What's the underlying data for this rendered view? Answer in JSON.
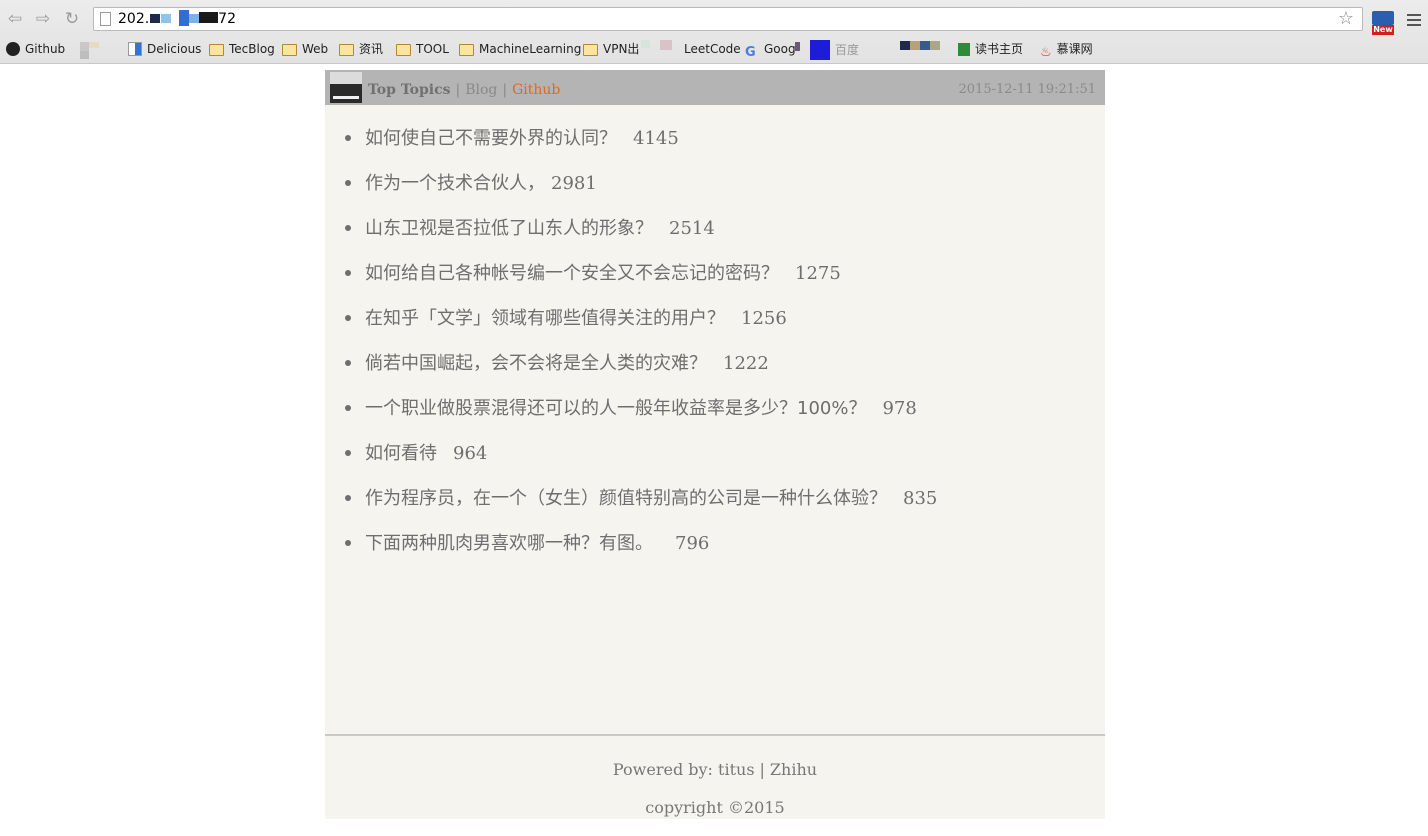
{
  "browser": {
    "url": "202.",
    "url_tail": "72",
    "bookmarks": [
      {
        "label": "Github",
        "icon": "github-icon"
      },
      {
        "label": "Delicious",
        "icon": "delicious-icon"
      },
      {
        "label": "TecBlog",
        "icon": "folder-icon"
      },
      {
        "label": "Web",
        "icon": "folder-icon"
      },
      {
        "label": "资讯",
        "icon": "folder-icon"
      },
      {
        "label": "TOOL",
        "icon": "folder-icon"
      },
      {
        "label": "MachineLearning",
        "icon": "folder-icon"
      },
      {
        "label": "VPN出",
        "icon": "folder-icon"
      },
      {
        "label": "LeetCode",
        "icon": "leetcode-icon"
      },
      {
        "label": "Goog",
        "icon": "google-icon"
      },
      {
        "label": "百度",
        "icon": "baidu-icon"
      },
      {
        "label": "读书主页",
        "icon": "book-icon"
      },
      {
        "label": "慕课网",
        "icon": "fire-icon"
      }
    ],
    "extension_badge": "New"
  },
  "header": {
    "brand": "Top Topics",
    "separator": "|",
    "blog": "Blog",
    "github": "Github",
    "datetime": "2015-12-11 19:21:51"
  },
  "topics": [
    {
      "title": "如何使自己不需要外界的认同？",
      "count": "4145"
    },
    {
      "title": "作为一个技术合伙人，",
      "count": "2981"
    },
    {
      "title": "山东卫视是否拉低了山东人的形象？",
      "count": "2514"
    },
    {
      "title": "如何给自己各种帐号编一个安全又不会忘记的密码？",
      "count": "1275"
    },
    {
      "title": "在知乎「文学」领域有哪些值得关注的用户？",
      "count": "1256"
    },
    {
      "title": "倘若中国崛起，会不会将是全人类的灾难？",
      "count": "1222"
    },
    {
      "title": "一个职业做股票混得还可以的人一般年收益率是多少？100%？",
      "count": "978"
    },
    {
      "title": "如何看待",
      "count": "964"
    },
    {
      "title": "作为程序员，在一个（女生）颜值特别高的公司是一种什么体验？",
      "count": "835"
    },
    {
      "title": "下面两种肌肉男喜欢哪一种？有图。",
      "count": "796"
    }
  ],
  "footer": {
    "powered_by": "Powered by:",
    "author": "titus",
    "separator": "|",
    "zhihu": "Zhihu",
    "copyright": "copyright ©2015"
  },
  "colors": {
    "page_bg": "#f5f4ee",
    "header_bg": "#b4b4b4",
    "github_link": "#e0691b",
    "text": "#6e6e6e"
  }
}
